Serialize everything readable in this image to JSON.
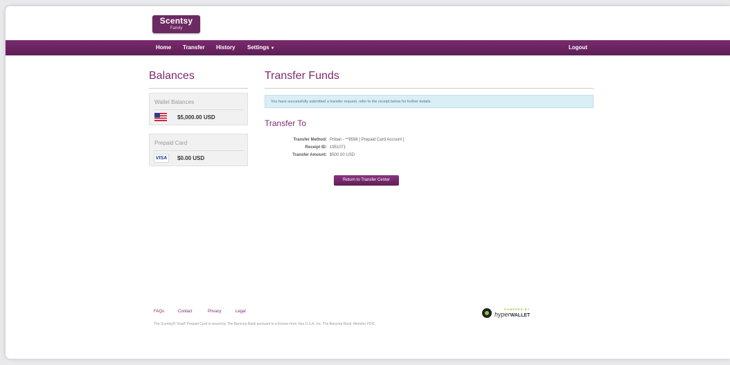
{
  "logo": {
    "line1": "Scentsy",
    "line2": "Family"
  },
  "nav": {
    "items": [
      "Home",
      "Transfer",
      "History",
      "Settings"
    ],
    "logout": "Logout"
  },
  "balances": {
    "title": "Balances",
    "wallet": {
      "title": "Wallet Balances",
      "amount": "$5,000.00 USD",
      "flag_icon": "us-flag-icon"
    },
    "prepaid": {
      "title": "Prepaid Card",
      "amount": "$0.00 USD",
      "card_label": "VISA"
    }
  },
  "transfer": {
    "title": "Transfer Funds",
    "alert": "You have successfully submitted a transfer request, refer to the receipt below for further details.",
    "subtitle": "Transfer To",
    "details": [
      {
        "label": "Transfer Method:",
        "value": "Priban - **8598 [ Prepaid Card Account ]"
      },
      {
        "label": "Receipt ID:",
        "value": "1951071"
      },
      {
        "label": "Transfer Amount:",
        "value": "$500.00 USD"
      }
    ],
    "button": "Return to Transfer Center"
  },
  "footer": {
    "links": [
      "FAQs",
      "Contact",
      "Privacy",
      "Legal"
    ],
    "disclaimer": "The Scentsy® Visa® Prepaid Card is issued by The Bancorp Bank pursuant to a license from Visa U.S.A. Inc. The Bancorp Bank; Member FDIC.",
    "powered": {
      "line1": "POWERED BY",
      "name1": "hyper",
      "name2": "WALLET"
    }
  },
  "colors": {
    "brand": "#6b2a62",
    "nav": "#6e2664",
    "alert_bg": "#d9eef5"
  }
}
